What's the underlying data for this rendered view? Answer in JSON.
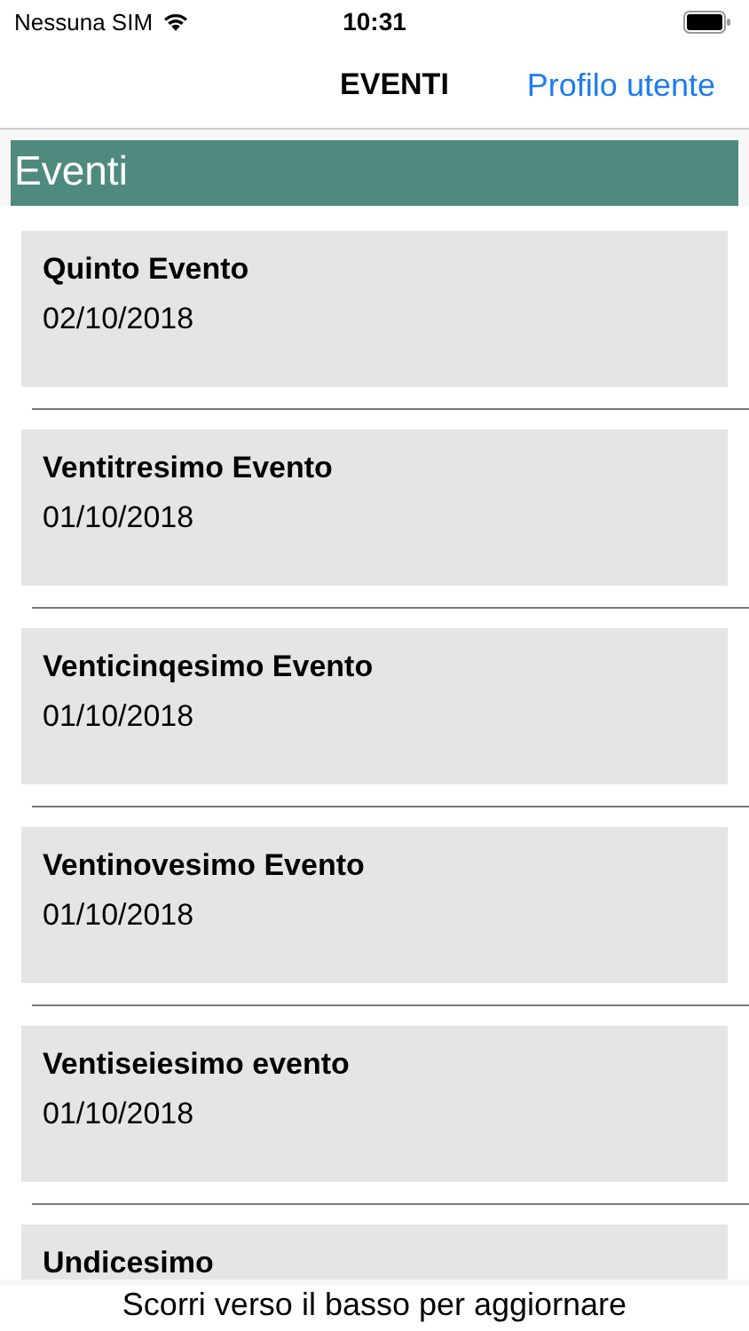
{
  "status_bar": {
    "carrier": "Nessuna SIM",
    "time": "10:31"
  },
  "nav": {
    "title": "EVENTI",
    "right_button": "Profilo utente"
  },
  "section_header": "Eventi",
  "events": [
    {
      "title": "Quinto Evento",
      "date": "02/10/2018"
    },
    {
      "title": "Ventitresimo Evento",
      "date": "01/10/2018"
    },
    {
      "title": "Venticinqesimo Evento",
      "date": "01/10/2018"
    },
    {
      "title": "Ventinovesimo Evento",
      "date": "01/10/2018"
    },
    {
      "title": "Ventiseiesimo evento",
      "date": "01/10/2018"
    },
    {
      "title": "Undicesimo"
    }
  ],
  "footer": "Scorri verso il basso per aggiornare"
}
